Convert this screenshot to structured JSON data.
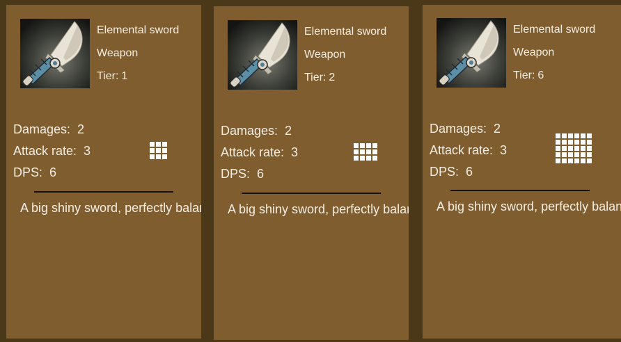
{
  "cards": [
    {
      "item_name": "Elemental sword",
      "item_type": "Weapon",
      "tier_label": "Tier:",
      "tier_value": "1",
      "damages_label": "Damages:",
      "damages_value": "2",
      "attack_rate_label": "Attack rate:",
      "attack_rate_value": "3",
      "dps_label": "DPS:",
      "dps_value": "6",
      "description": "A big shiny sword, perfectly balanced",
      "icon": "sword-icon",
      "tier_grid": {
        "cols": 3,
        "rows": 3
      }
    },
    {
      "item_name": "Elemental sword",
      "item_type": "Weapon",
      "tier_label": "Tier:",
      "tier_value": "2",
      "damages_label": "Damages:",
      "damages_value": "2",
      "attack_rate_label": "Attack rate:",
      "attack_rate_value": "3",
      "dps_label": "DPS:",
      "dps_value": "6",
      "description": "A big shiny sword, perfectly balanced",
      "icon": "sword-icon",
      "tier_grid": {
        "cols": 4,
        "rows": 3
      }
    },
    {
      "item_name": "Elemental sword",
      "item_type": "Weapon",
      "tier_label": "Tier:",
      "tier_value": "6",
      "damages_label": "Damages:",
      "damages_value": "2",
      "attack_rate_label": "Attack rate:",
      "attack_rate_value": "3",
      "dps_label": "DPS:",
      "dps_value": "6",
      "description": "A big shiny sword, perfectly balanced",
      "icon": "sword-icon",
      "tier_grid": {
        "cols": 6,
        "rows": 5
      }
    }
  ],
  "colors": {
    "card_background": "#805d2e",
    "page_background": "#4a3818",
    "text": "#f2ede2",
    "divider": "#161208"
  }
}
